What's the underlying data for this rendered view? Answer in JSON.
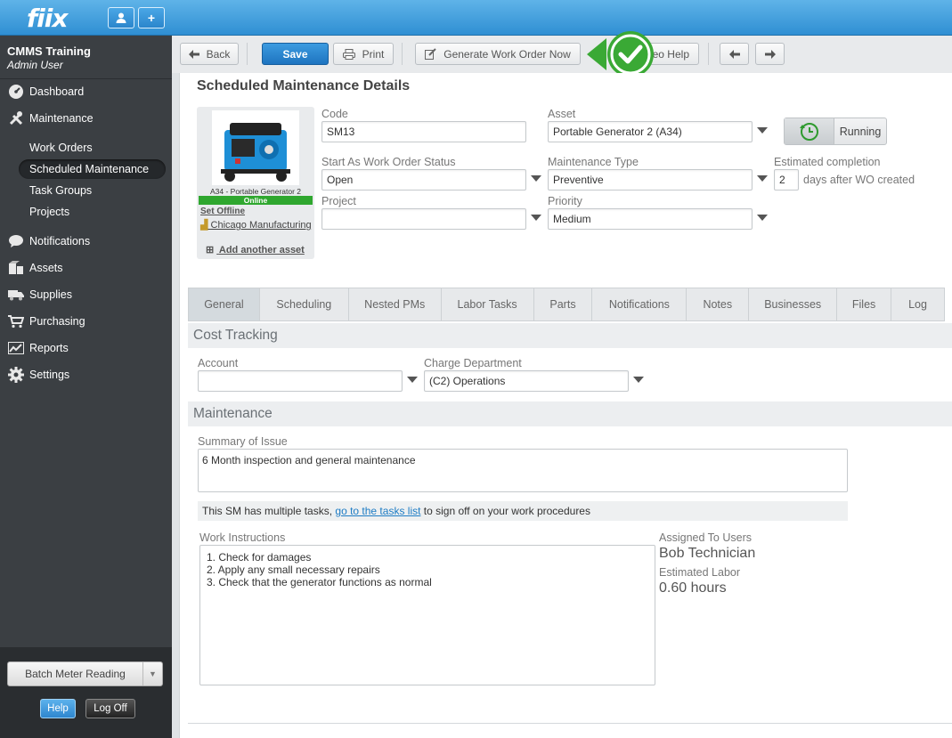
{
  "app": {
    "logo": "fiix"
  },
  "topbar": {
    "user_icon": "user-icon",
    "add_icon": "plus-icon",
    "add_label": "+"
  },
  "sidebar": {
    "org_name": "CMMS Training",
    "role": "Admin User",
    "items": [
      {
        "label": "Dashboard",
        "icon": "dashboard-icon"
      },
      {
        "label": "Maintenance",
        "icon": "tools-icon"
      },
      {
        "label": "Notifications",
        "icon": "speech-bubble-icon"
      },
      {
        "label": "Assets",
        "icon": "boxes-icon"
      },
      {
        "label": "Supplies",
        "icon": "truck-icon"
      },
      {
        "label": "Purchasing",
        "icon": "cart-icon"
      },
      {
        "label": "Reports",
        "icon": "chart-icon"
      },
      {
        "label": "Settings",
        "icon": "gear-icon"
      }
    ],
    "sub_items": [
      {
        "label": "Work Orders"
      },
      {
        "label": "Scheduled Maintenance",
        "active": true
      },
      {
        "label": "Task Groups"
      },
      {
        "label": "Projects"
      }
    ],
    "batch_label": "Batch Meter Reading",
    "help_label": "Help",
    "logoff_label": "Log Off"
  },
  "toolbar": {
    "back_label": "Back",
    "save_label": "Save",
    "print_label": "Print",
    "generate_label": "Generate Work Order Now",
    "video_help_label": "eo Help"
  },
  "page": {
    "title": "Scheduled Maintenance Details"
  },
  "asset_card": {
    "caption": "A34 - Portable Generator 2",
    "status": "Online",
    "set_offline": "Set Offline",
    "location": "Chicago Manufacturing",
    "add_asset": "Add another asset"
  },
  "form": {
    "code_label": "Code",
    "code_value": "SM13",
    "asset_label": "Asset",
    "asset_value": "Portable Generator 2 (A34)",
    "running_label": "Running",
    "status_label": "Start As Work Order Status",
    "status_value": "Open",
    "mtype_label": "Maintenance Type",
    "mtype_value": "Preventive",
    "est_label": "Estimated completion",
    "est_value": "2",
    "est_suffix": "days after WO created",
    "project_label": "Project",
    "project_value": "",
    "priority_label": "Priority",
    "priority_value": "Medium"
  },
  "tabs": [
    "General",
    "Scheduling",
    "Nested PMs",
    "Labor Tasks",
    "Parts",
    "Notifications",
    "Notes",
    "Businesses",
    "Files",
    "Log"
  ],
  "cost": {
    "title": "Cost Tracking",
    "account_label": "Account",
    "account_value": "",
    "charge_label": "Charge Department",
    "charge_value": "(C2) Operations"
  },
  "maintenance": {
    "title": "Maintenance",
    "summary_label": "Summary of Issue",
    "summary_value": "6 Month inspection and general maintenance",
    "tasks_note_pre": "This SM has multiple tasks, ",
    "tasks_note_link": "go to the tasks list",
    "tasks_note_post": " to sign off on your work procedures",
    "wi_label": "Work Instructions",
    "wi_lines": [
      "1.  Check for damages",
      "2.  Apply any small necessary repairs",
      "3.  Check that the generator functions as normal"
    ],
    "assigned_label": "Assigned To Users",
    "assigned_value": "Bob Technician",
    "labor_label": "Estimated Labor",
    "labor_value": "0.60 hours"
  },
  "colors": {
    "topbar": "#2f8fd3",
    "sidebar": "#3b3f43",
    "primary": "#1e74c0",
    "online": "#2fa72f",
    "callout": "#3aa935"
  }
}
